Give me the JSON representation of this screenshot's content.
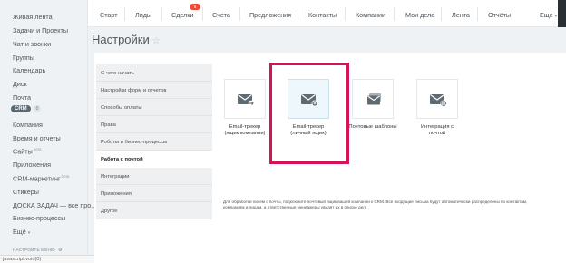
{
  "sidebar": {
    "items": [
      {
        "label": "Живая лента"
      },
      {
        "label": "Задачи и Проекты"
      },
      {
        "label": "Чат и звонки"
      },
      {
        "label": "Группы"
      },
      {
        "label": "Календарь"
      },
      {
        "label": "Диск"
      },
      {
        "label": "Почта"
      }
    ],
    "crm": {
      "label": "CRM",
      "count": "0"
    },
    "items2": [
      {
        "label": "Компания"
      },
      {
        "label": "Время и отчеты"
      },
      {
        "label": "Сайты",
        "sup": "beta"
      },
      {
        "label": "Приложения"
      },
      {
        "label": "CRM-маркетинг",
        "sup": "beta"
      },
      {
        "label": "Стикеры"
      },
      {
        "label": "ДОСКА ЗАДАЧ — все про..."
      },
      {
        "label": "Бизнес-процессы"
      },
      {
        "label": "Ещё"
      }
    ],
    "settings_label": "НАСТРОИТЬ МЕНЮ"
  },
  "statusbar": {
    "text": "javascript:void(0)"
  },
  "topnav": {
    "items": [
      "Старт",
      "Лиды",
      "Сделки",
      "Счета",
      "Предложения",
      "Контакты",
      "Компании",
      "Мои дела",
      "Лента",
      "Отчёты",
      "Еще"
    ],
    "deals_badge": "6"
  },
  "page": {
    "title": "Настройки",
    "star": "☆"
  },
  "menu": {
    "items": [
      {
        "label": "С чего начать"
      },
      {
        "label": "Настройки форм и отчетов"
      },
      {
        "label": "Способы оплаты"
      },
      {
        "label": "Права"
      },
      {
        "label": "Роботы и бизнес-процессы"
      },
      {
        "label": "Работа с почтой",
        "active": true
      },
      {
        "label": "Интеграции"
      },
      {
        "label": "Приложения"
      },
      {
        "label": "Другое"
      }
    ]
  },
  "tiles": [
    {
      "line1": "Email-трекер",
      "line2": "(ящик компании)",
      "icon": "mail-send-icon"
    },
    {
      "line1": "Email-трекер",
      "line2": "(личный ящик)",
      "icon": "mail-add-icon",
      "selected": true
    },
    {
      "line1": "Почтовые шаблоны",
      "line2": "",
      "icon": "mail-templates-icon"
    },
    {
      "line1": "Интеграция с",
      "line2": "почтой",
      "icon": "mail-settings-icon"
    }
  ],
  "info": {
    "text": "Для обработки писем с почты, подключите почтовый ящик вашей компании к CRM. Все входящие письма будут автоматически распределены по контактам, компаниям и лидам, а ответственные менеджеры увидят их в списке дел."
  },
  "colors": {
    "highlight": "#d4145a",
    "badge": "#f04a3a",
    "crm_badge": "#5a6a75"
  }
}
